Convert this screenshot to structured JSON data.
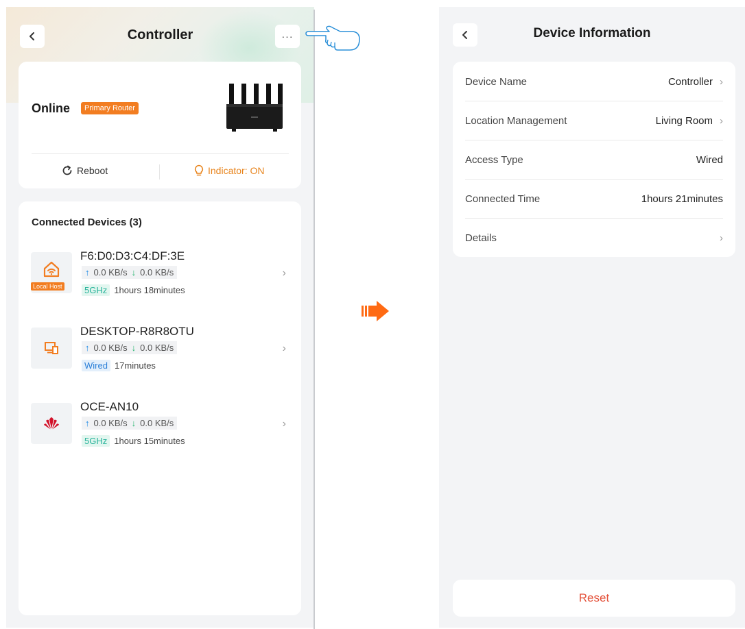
{
  "left": {
    "title": "Controller",
    "more_label": "···",
    "status": "Online",
    "role_badge": "Primary Router",
    "reboot_label": "Reboot",
    "indicator_label": "Indicator: ON",
    "devices_title": "Connected Devices (3)",
    "devices": [
      {
        "name": "F6:D0:D3:C4:DF:3E",
        "icon": "smart-home-icon",
        "tag": "Local Host",
        "upload": "0.0 KB/s",
        "download": "0.0 KB/s",
        "band": "5GHz",
        "time": "1hours 18minutes"
      },
      {
        "name": "DESKTOP-R8R8OTU",
        "icon": "computer-icon",
        "tag": "",
        "upload": "0.0 KB/s",
        "download": "0.0 KB/s",
        "band": "Wired",
        "time": "17minutes"
      },
      {
        "name": "OCE-AN10",
        "icon": "huawei-logo-icon",
        "tag": "",
        "upload": "0.0 KB/s",
        "download": "0.0 KB/s",
        "band": "5GHz",
        "time": "1hours 15minutes"
      }
    ]
  },
  "right": {
    "title": "Device Information",
    "rows": [
      {
        "label": "Device Name",
        "value": "Controller",
        "chevron": true
      },
      {
        "label": "Location Management",
        "value": "Living Room",
        "chevron": true
      },
      {
        "label": "Access Type",
        "value": "Wired",
        "chevron": false
      },
      {
        "label": "Connected Time",
        "value": "1hours 21minutes",
        "chevron": false
      },
      {
        "label": "Details",
        "value": "",
        "chevron": true
      }
    ],
    "reset_label": "Reset"
  },
  "colors": {
    "accent_orange": "#f27d21",
    "reset_red": "#e4523b",
    "upload_blue": "#1a88e6",
    "download_green": "#2bb673"
  }
}
